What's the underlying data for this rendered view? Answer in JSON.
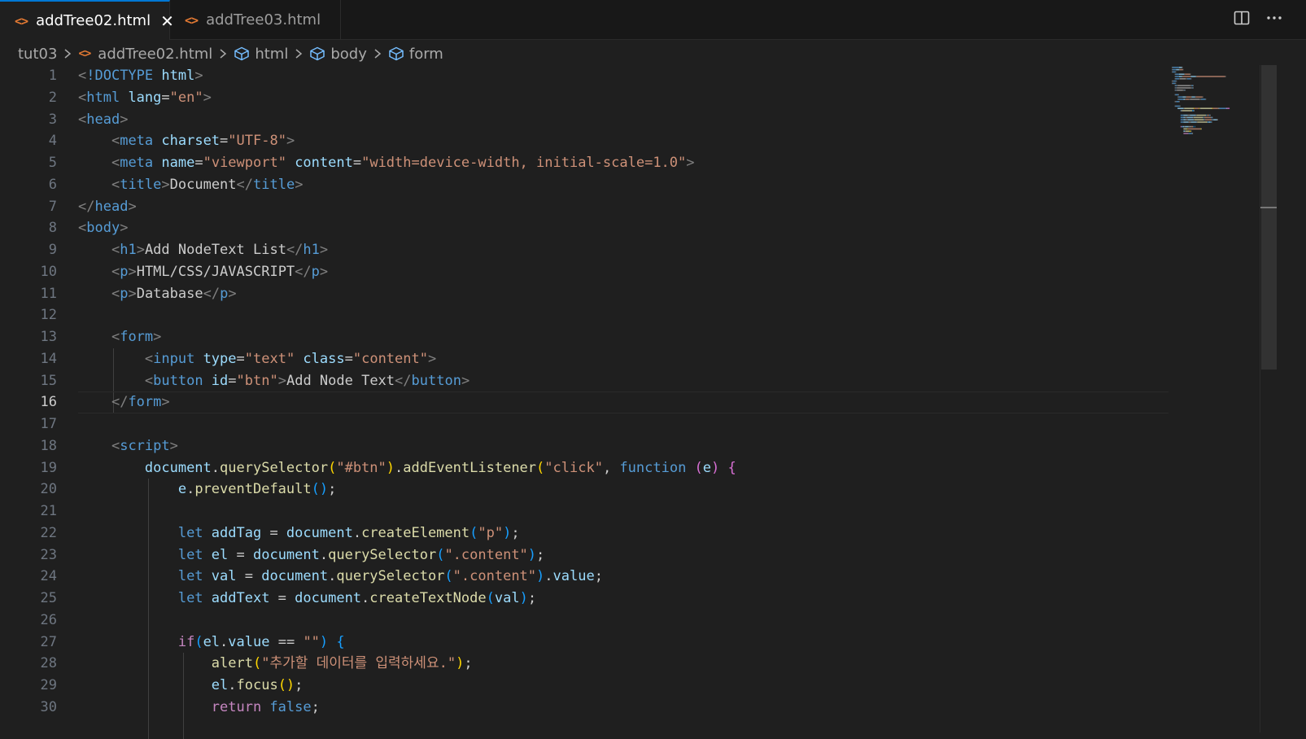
{
  "tabs": [
    {
      "label": "addTree02.html",
      "active": true,
      "icon": "html-file-icon"
    },
    {
      "label": "addTree03.html",
      "active": false,
      "icon": "html-file-icon"
    }
  ],
  "breadcrumb": [
    {
      "label": "tut03",
      "icon": ""
    },
    {
      "label": "addTree02.html",
      "icon": "html-file-icon"
    },
    {
      "label": "html",
      "icon": "cube-icon"
    },
    {
      "label": "body",
      "icon": "cube-icon"
    },
    {
      "label": "form",
      "icon": "cube-icon"
    }
  ],
  "current_line": 16,
  "line_numbers": [
    "1",
    "2",
    "3",
    "4",
    "5",
    "6",
    "7",
    "8",
    "9",
    "10",
    "11",
    "12",
    "13",
    "14",
    "15",
    "16",
    "17",
    "18",
    "19",
    "20",
    "21",
    "22",
    "23",
    "24",
    "25",
    "26",
    "27",
    "28",
    "29",
    "30"
  ],
  "code_lines": [
    [
      [
        "ang",
        "<"
      ],
      [
        "tag",
        "!DOCTYPE "
      ],
      [
        "attr",
        "html"
      ],
      [
        "ang",
        ">"
      ]
    ],
    [
      [
        "ang",
        "<"
      ],
      [
        "tag",
        "html "
      ],
      [
        "attr",
        "lang"
      ],
      [
        "txt",
        "="
      ],
      [
        "str",
        "\"en\""
      ],
      [
        "ang",
        ">"
      ]
    ],
    [
      [
        "ang",
        "<"
      ],
      [
        "tag",
        "head"
      ],
      [
        "ang",
        ">"
      ]
    ],
    [
      [
        "txt",
        "    "
      ],
      [
        "ang",
        "<"
      ],
      [
        "tag",
        "meta "
      ],
      [
        "attr",
        "charset"
      ],
      [
        "txt",
        "="
      ],
      [
        "str",
        "\"UTF-8\""
      ],
      [
        "ang",
        ">"
      ]
    ],
    [
      [
        "txt",
        "    "
      ],
      [
        "ang",
        "<"
      ],
      [
        "tag",
        "meta "
      ],
      [
        "attr",
        "name"
      ],
      [
        "txt",
        "="
      ],
      [
        "str",
        "\"viewport\" "
      ],
      [
        "attr",
        "content"
      ],
      [
        "txt",
        "="
      ],
      [
        "str",
        "\"width=device-width, initial-scale=1.0\""
      ],
      [
        "ang",
        ">"
      ]
    ],
    [
      [
        "txt",
        "    "
      ],
      [
        "ang",
        "<"
      ],
      [
        "tag",
        "title"
      ],
      [
        "ang",
        ">"
      ],
      [
        "txt",
        "Document"
      ],
      [
        "ang",
        "</"
      ],
      [
        "tag",
        "title"
      ],
      [
        "ang",
        ">"
      ]
    ],
    [
      [
        "ang",
        "</"
      ],
      [
        "tag",
        "head"
      ],
      [
        "ang",
        ">"
      ]
    ],
    [
      [
        "ang",
        "<"
      ],
      [
        "tag",
        "body"
      ],
      [
        "ang",
        ">"
      ]
    ],
    [
      [
        "txt",
        "    "
      ],
      [
        "ang",
        "<"
      ],
      [
        "tag",
        "h1"
      ],
      [
        "ang",
        ">"
      ],
      [
        "txt",
        "Add NodeText List"
      ],
      [
        "ang",
        "</"
      ],
      [
        "tag",
        "h1"
      ],
      [
        "ang",
        ">"
      ]
    ],
    [
      [
        "txt",
        "    "
      ],
      [
        "ang",
        "<"
      ],
      [
        "tag",
        "p"
      ],
      [
        "ang",
        ">"
      ],
      [
        "txt",
        "HTML/CSS/JAVASCRIPT"
      ],
      [
        "ang",
        "</"
      ],
      [
        "tag",
        "p"
      ],
      [
        "ang",
        ">"
      ]
    ],
    [
      [
        "txt",
        "    "
      ],
      [
        "ang",
        "<"
      ],
      [
        "tag",
        "p"
      ],
      [
        "ang",
        ">"
      ],
      [
        "txt",
        "Database"
      ],
      [
        "ang",
        "</"
      ],
      [
        "tag",
        "p"
      ],
      [
        "ang",
        ">"
      ]
    ],
    [],
    [
      [
        "txt",
        "    "
      ],
      [
        "ang",
        "<"
      ],
      [
        "tag",
        "form"
      ],
      [
        "ang",
        ">"
      ]
    ],
    [
      [
        "txt",
        "        "
      ],
      [
        "ang",
        "<"
      ],
      [
        "tag",
        "input "
      ],
      [
        "attr",
        "type"
      ],
      [
        "txt",
        "="
      ],
      [
        "str",
        "\"text\" "
      ],
      [
        "attr",
        "class"
      ],
      [
        "txt",
        "="
      ],
      [
        "str",
        "\"content\""
      ],
      [
        "ang",
        ">"
      ]
    ],
    [
      [
        "txt",
        "        "
      ],
      [
        "ang",
        "<"
      ],
      [
        "tag",
        "button "
      ],
      [
        "attr",
        "id"
      ],
      [
        "txt",
        "="
      ],
      [
        "str",
        "\"btn\""
      ],
      [
        "ang",
        ">"
      ],
      [
        "txt",
        "Add Node Text"
      ],
      [
        "ang",
        "</"
      ],
      [
        "tag",
        "button"
      ],
      [
        "ang",
        ">"
      ]
    ],
    [
      [
        "txt",
        "    "
      ],
      [
        "ang",
        "</"
      ],
      [
        "tag",
        "form"
      ],
      [
        "ang",
        ">"
      ]
    ],
    [],
    [
      [
        "txt",
        "    "
      ],
      [
        "ang",
        "<"
      ],
      [
        "tag",
        "script"
      ],
      [
        "ang",
        ">"
      ]
    ],
    [
      [
        "txt",
        "        "
      ],
      [
        "var",
        "document"
      ],
      [
        "txt",
        "."
      ],
      [
        "fn",
        "querySelector"
      ],
      [
        "p1",
        "("
      ],
      [
        "str",
        "\"#btn\""
      ],
      [
        "p1",
        ")"
      ],
      [
        "txt",
        "."
      ],
      [
        "fn",
        "addEventListener"
      ],
      [
        "p1",
        "("
      ],
      [
        "str",
        "\"click\""
      ],
      [
        "txt",
        ", "
      ],
      [
        "kw",
        "function "
      ],
      [
        "p2",
        "("
      ],
      [
        "var",
        "e"
      ],
      [
        "p2",
        ") {"
      ]
    ],
    [
      [
        "txt",
        "            "
      ],
      [
        "var",
        "e"
      ],
      [
        "txt",
        "."
      ],
      [
        "fn",
        "preventDefault"
      ],
      [
        "p3",
        "()"
      ],
      [
        "txt",
        ";"
      ]
    ],
    [],
    [
      [
        "txt",
        "            "
      ],
      [
        "kw",
        "let "
      ],
      [
        "var",
        "addTag"
      ],
      [
        "txt",
        " = "
      ],
      [
        "var",
        "document"
      ],
      [
        "txt",
        "."
      ],
      [
        "fn",
        "createElement"
      ],
      [
        "p3",
        "("
      ],
      [
        "str",
        "\"p\""
      ],
      [
        "p3",
        ")"
      ],
      [
        "txt",
        ";"
      ]
    ],
    [
      [
        "txt",
        "            "
      ],
      [
        "kw",
        "let "
      ],
      [
        "var",
        "el"
      ],
      [
        "txt",
        " = "
      ],
      [
        "var",
        "document"
      ],
      [
        "txt",
        "."
      ],
      [
        "fn",
        "querySelector"
      ],
      [
        "p3",
        "("
      ],
      [
        "str",
        "\".content\""
      ],
      [
        "p3",
        ")"
      ],
      [
        "txt",
        ";"
      ]
    ],
    [
      [
        "txt",
        "            "
      ],
      [
        "kw",
        "let "
      ],
      [
        "var",
        "val"
      ],
      [
        "txt",
        " = "
      ],
      [
        "var",
        "document"
      ],
      [
        "txt",
        "."
      ],
      [
        "fn",
        "querySelector"
      ],
      [
        "p3",
        "("
      ],
      [
        "str",
        "\".content\""
      ],
      [
        "p3",
        ")"
      ],
      [
        "txt",
        "."
      ],
      [
        "var",
        "value"
      ],
      [
        "txt",
        ";"
      ]
    ],
    [
      [
        "txt",
        "            "
      ],
      [
        "kw",
        "let "
      ],
      [
        "var",
        "addText"
      ],
      [
        "txt",
        " = "
      ],
      [
        "var",
        "document"
      ],
      [
        "txt",
        "."
      ],
      [
        "fn",
        "createTextNode"
      ],
      [
        "p3",
        "("
      ],
      [
        "var",
        "val"
      ],
      [
        "p3",
        ")"
      ],
      [
        "txt",
        ";"
      ]
    ],
    [],
    [
      [
        "txt",
        "            "
      ],
      [
        "ctrl",
        "if"
      ],
      [
        "p3",
        "("
      ],
      [
        "var",
        "el"
      ],
      [
        "txt",
        "."
      ],
      [
        "var",
        "value"
      ],
      [
        "txt",
        " == "
      ],
      [
        "str",
        "\"\""
      ],
      [
        "p3",
        ")"
      ],
      [
        "txt",
        " "
      ],
      [
        "p3",
        "{"
      ]
    ],
    [
      [
        "txt",
        "                "
      ],
      [
        "fn",
        "alert"
      ],
      [
        "p1",
        "("
      ],
      [
        "str",
        "\"추가할 데이터를 입력하세요.\""
      ],
      [
        "p1",
        ")"
      ],
      [
        "txt",
        ";"
      ]
    ],
    [
      [
        "txt",
        "                "
      ],
      [
        "var",
        "el"
      ],
      [
        "txt",
        "."
      ],
      [
        "fn",
        "focus"
      ],
      [
        "p1",
        "()"
      ],
      [
        "txt",
        ";"
      ]
    ],
    [
      [
        "txt",
        "                "
      ],
      [
        "ctrl",
        "return "
      ],
      [
        "kw",
        "false"
      ],
      [
        "txt",
        ";"
      ]
    ]
  ],
  "colors": {
    "accent": "#0078d4",
    "editor_bg": "#1f1f1f",
    "tab_bar_bg": "#181818",
    "html_icon": "#e37933"
  },
  "toolbar_icons": [
    "split-editor-icon",
    "more-actions-icon"
  ]
}
